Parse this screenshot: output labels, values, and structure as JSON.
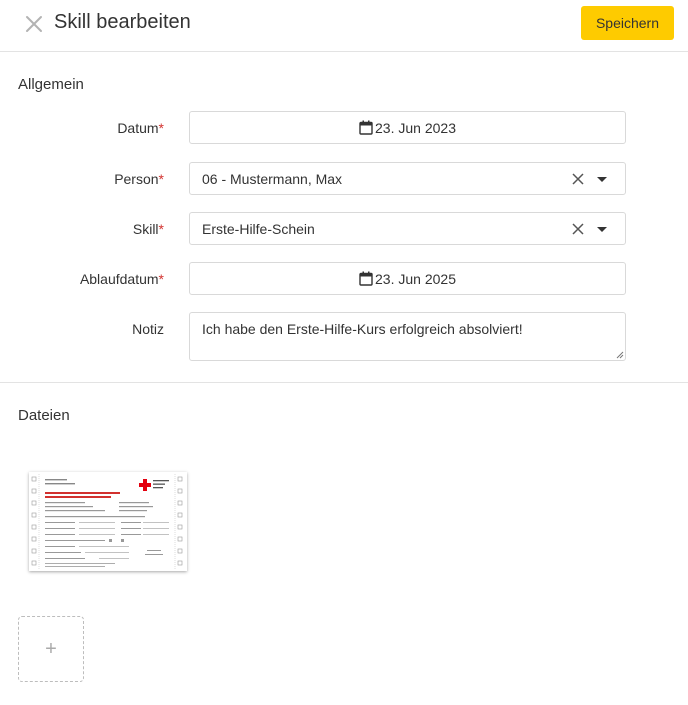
{
  "header": {
    "title": "Skill bearbeiten",
    "save_label": "Speichern",
    "accent": "#fecb00"
  },
  "general": {
    "section_title": "Allgemein",
    "date": {
      "label": "Datum",
      "value": "23. Jun 2023"
    },
    "person": {
      "label": "Person",
      "value": "06 - Mustermann, Max"
    },
    "skill": {
      "label": "Skill",
      "value": "Erste-Hilfe-Schein"
    },
    "expiry": {
      "label": "Ablaufdatum",
      "value": "23. Jun 2025"
    },
    "note": {
      "label": "Notiz",
      "value": "Ich habe den Erste-Hilfe-Kurs erfolgreich absolviert!"
    }
  },
  "required_marker": "*",
  "files": {
    "section_title": "Dateien",
    "thumbnail_icon": "certificate-document-icon",
    "add_label": "+"
  }
}
